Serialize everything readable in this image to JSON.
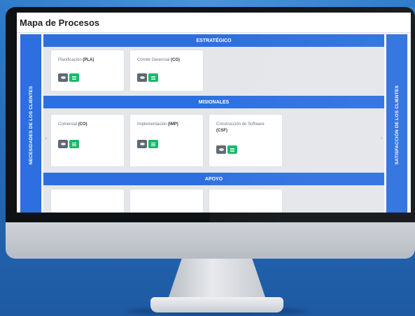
{
  "window": {
    "title": "Mapa de Procesos"
  },
  "sides": {
    "left_label": "NECESIDADES DE LOS CLIENTES",
    "right_label": "SATISFACCIÓN DE LOS CLIENTES"
  },
  "sections": [
    {
      "heading": "ESTRATÉGICO",
      "cards": [
        {
          "name": "Planificación",
          "code": "(PLA)"
        },
        {
          "name": "Comité Gerencial",
          "code": "(CG)"
        }
      ]
    },
    {
      "heading": "MISIONALES",
      "cards": [
        {
          "name": "Comercial",
          "code": "(CO)"
        },
        {
          "name": "Implementación",
          "code": "(IMP)"
        },
        {
          "name": "Construcción de Software",
          "code": "(CSF)"
        }
      ]
    },
    {
      "heading": "APOYO",
      "cards": []
    }
  ],
  "icons": {
    "view": "eye-icon",
    "list": "list-icon",
    "prev": "chevron-left-icon",
    "next": "chevron-right-icon"
  },
  "colors": {
    "accent_blue": "#2d6fe0",
    "view_button": "#5f6770",
    "list_button": "#19b86b",
    "background": "#2a72c0"
  }
}
